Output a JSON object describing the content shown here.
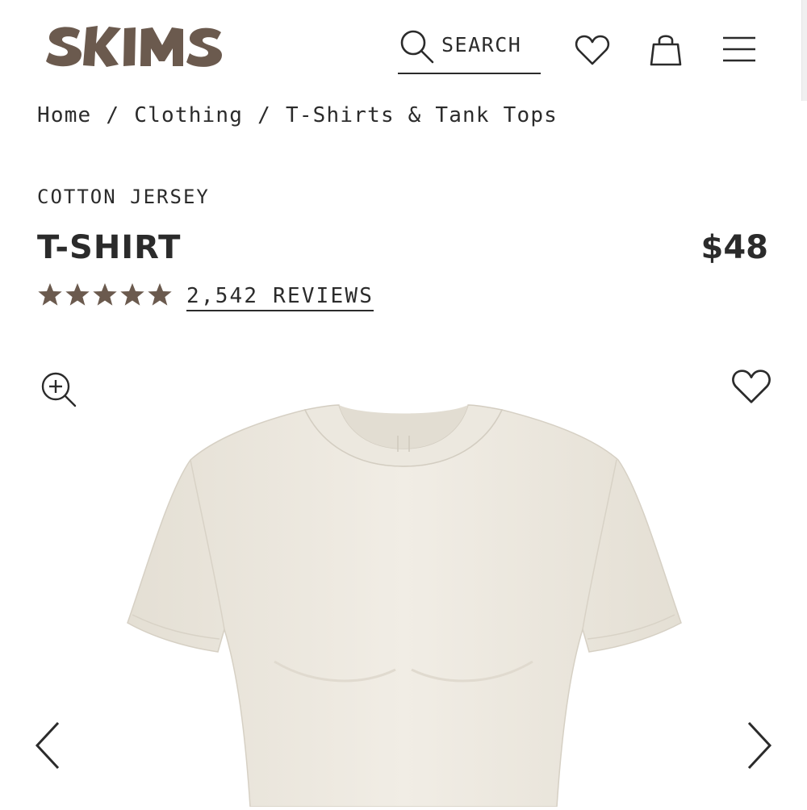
{
  "header": {
    "logo_text": "SKIMS",
    "search_label": "SEARCH",
    "icons": [
      "search-icon",
      "heart-icon",
      "shopping-bag-icon",
      "menu-icon"
    ]
  },
  "breadcrumb": {
    "items": [
      "Home",
      "Clothing",
      "T-Shirts & Tank Tops"
    ],
    "separator": "/"
  },
  "product": {
    "collection": "COTTON JERSEY",
    "title": "T-SHIRT",
    "price": "$48",
    "rating": 5,
    "rating_max": 5,
    "reviews_label": "2,542 REVIEWS"
  },
  "gallery": {
    "image_subject": "ivory cotton jersey short-sleeve t-shirt",
    "icons": [
      "zoom-in-icon",
      "heart-icon",
      "chevron-left-icon",
      "chevron-right-icon"
    ]
  },
  "colors": {
    "text": "#2b2b2b",
    "logo_brown": "#6b5a4e",
    "star_brown": "#6b5a4e",
    "garment": "#ede9df"
  }
}
